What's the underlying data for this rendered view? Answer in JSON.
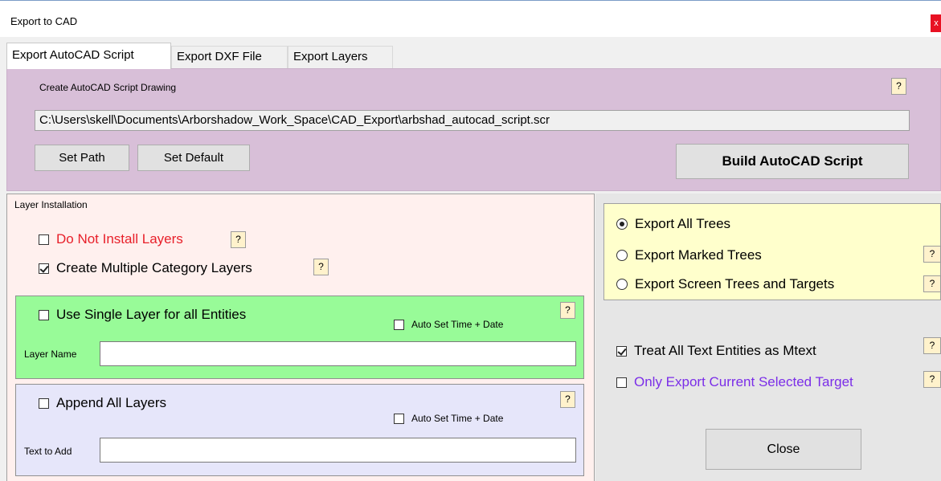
{
  "window": {
    "title": "Export to CAD",
    "close_glyph": "x"
  },
  "tabs": [
    "Export AutoCAD Script",
    "Export DXF File",
    "Export Layers"
  ],
  "script_panel": {
    "heading": "Create AutoCAD Script Drawing",
    "help": "?",
    "path": "C:\\Users\\skell\\Documents\\Arborshadow_Work_Space\\CAD_Export\\arbshad_autocad_script.scr",
    "set_path": "Set Path",
    "set_default": "Set Default",
    "build": "Build AutoCAD Script"
  },
  "layer_installation": {
    "heading": "Layer Installation",
    "do_not_install": {
      "label": "Do Not Install Layers",
      "checked": false,
      "color": "#e8202a"
    },
    "multiple_category": {
      "label": "Create Multiple Category Layers",
      "checked": true
    },
    "help": "?"
  },
  "single_layer": {
    "label": "Use Single Layer for all Entities",
    "checked": false,
    "auto_set": "Auto Set Time + Date",
    "field_label": "Layer Name",
    "field_value": "",
    "help": "?",
    "color": "#98fb98"
  },
  "append_layers": {
    "label": "Append All Layers",
    "checked": false,
    "auto_set": "Auto Set Time + Date",
    "field_label": "Text to Add",
    "field_value": "",
    "help": "?",
    "color": "#e6e6fa"
  },
  "export_options": {
    "all_trees": "Export All Trees",
    "marked_trees": "Export Marked Trees",
    "screen_trees": "Export Screen Trees and Targets",
    "selected": "all_trees",
    "help": "?",
    "color": "#ffffcc"
  },
  "text_options": {
    "mtext": {
      "label": "Treat All Text Entities as Mtext",
      "checked": true
    },
    "current_target": {
      "label": "Only Export Current Selected Target",
      "checked": false,
      "color": "#7b2ee8"
    },
    "help": "?"
  },
  "close_button": "Close"
}
